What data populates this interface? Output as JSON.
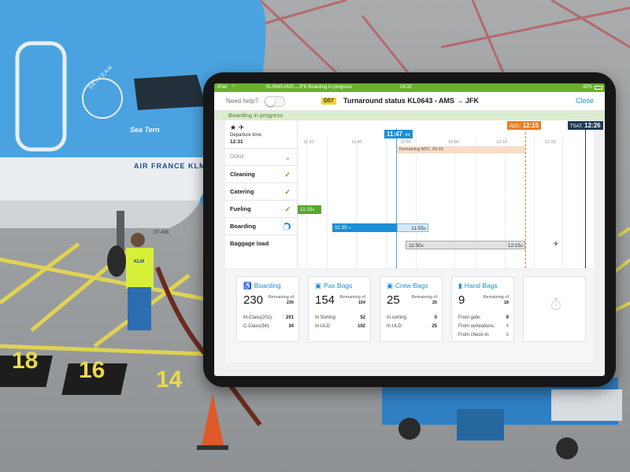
{
  "background": {
    "aircraft_alliance_text": "SKYTEAM",
    "aircraft_name": "Sea Tern",
    "aircraft_livery_text": "AIR FRANCE KLM",
    "aircraft_registration": "XT-405",
    "vest_text": "KLM",
    "stand_numbers": [
      "18",
      "16",
      "14"
    ]
  },
  "status_bar": {
    "device": "iPad",
    "flight_route": "KL0643  AMS→JFK  Boarding in progress",
    "time": "16:32",
    "battery": "42%"
  },
  "header": {
    "help_label": "Need help?",
    "gate": "D57",
    "title": "Turnaround status KL0643 - AMS → JFK",
    "close_label": "Close"
  },
  "phase": "Boarding in progress",
  "departure": {
    "icons": "★ ✈",
    "label": "Departure time:",
    "time": "12:31"
  },
  "tasks": {
    "done_label": "DONE",
    "items": [
      {
        "name": "Cleaning",
        "status": "✓"
      },
      {
        "name": "Catering",
        "status": "✓"
      },
      {
        "name": "Fueling",
        "status": "✓"
      },
      {
        "name": "Boarding",
        "status": ""
      },
      {
        "name": "Baggage load",
        "status": ""
      }
    ]
  },
  "timeline": {
    "ticks": [
      "11:30",
      "11:40",
      "11:50",
      "12:00",
      "12:10",
      "12:20"
    ],
    "now_time": "11:47",
    "now_offset": "-44",
    "adc_label": "ADC:",
    "adc_time": "12:15",
    "tsat_label": "TSAT:",
    "tsat_time": "12:26",
    "remaining_adc": "Remaining ADC: 00:16",
    "remaining_adc_sup": "16",
    "fueling_bar": "11:33",
    "fueling_bar_sup": "A",
    "boarding_start": "11:35",
    "boarding_start_sup": "A",
    "boarding_end": "11:55",
    "boarding_end_sup": "S",
    "baggage_start": "11:50",
    "baggage_start_sup": "S",
    "baggage_end": "12:15",
    "baggage_end_sup": "S",
    "plane_icon": "✈"
  },
  "cards": {
    "boarding": {
      "title": "Boarding",
      "icon": "♿",
      "value": "230",
      "remaining_label": "Remaining of",
      "remaining_value": "230",
      "rows": [
        {
          "k": "M-Class(201):",
          "v": "201"
        },
        {
          "k": "C-Class(34):",
          "v": "34"
        }
      ]
    },
    "pax_bags": {
      "title": "Pax Bags",
      "icon": "▣",
      "value": "154",
      "remaining_label": "Remaining of",
      "remaining_value": "154",
      "rows": [
        {
          "k": "In Sorting:",
          "v": "52"
        },
        {
          "k": "In ULD:",
          "v": "102"
        }
      ]
    },
    "crew_bags": {
      "title": "Crew Bags",
      "icon": "▣",
      "value": "25",
      "remaining_label": "Remaining of",
      "remaining_value": "25",
      "rows": [
        {
          "k": "In sorting:",
          "v": "0"
        },
        {
          "k": "In ULD:",
          "v": "25"
        }
      ]
    },
    "hand_bags": {
      "title": "Hand Bags",
      "icon": "▮",
      "value": "9",
      "remaining_label": "Remaining of",
      "remaining_value": "18",
      "rows": [
        {
          "k": "From gate:",
          "v": "9"
        },
        {
          "k": "From outstations:",
          "v": "4"
        },
        {
          "k": "From check-in:",
          "v": "5"
        }
      ]
    }
  },
  "colors": {
    "klm_blue": "#1b8fd6",
    "green": "#6ab02e",
    "orange": "#ee7d23",
    "navy": "#1d3b57"
  }
}
